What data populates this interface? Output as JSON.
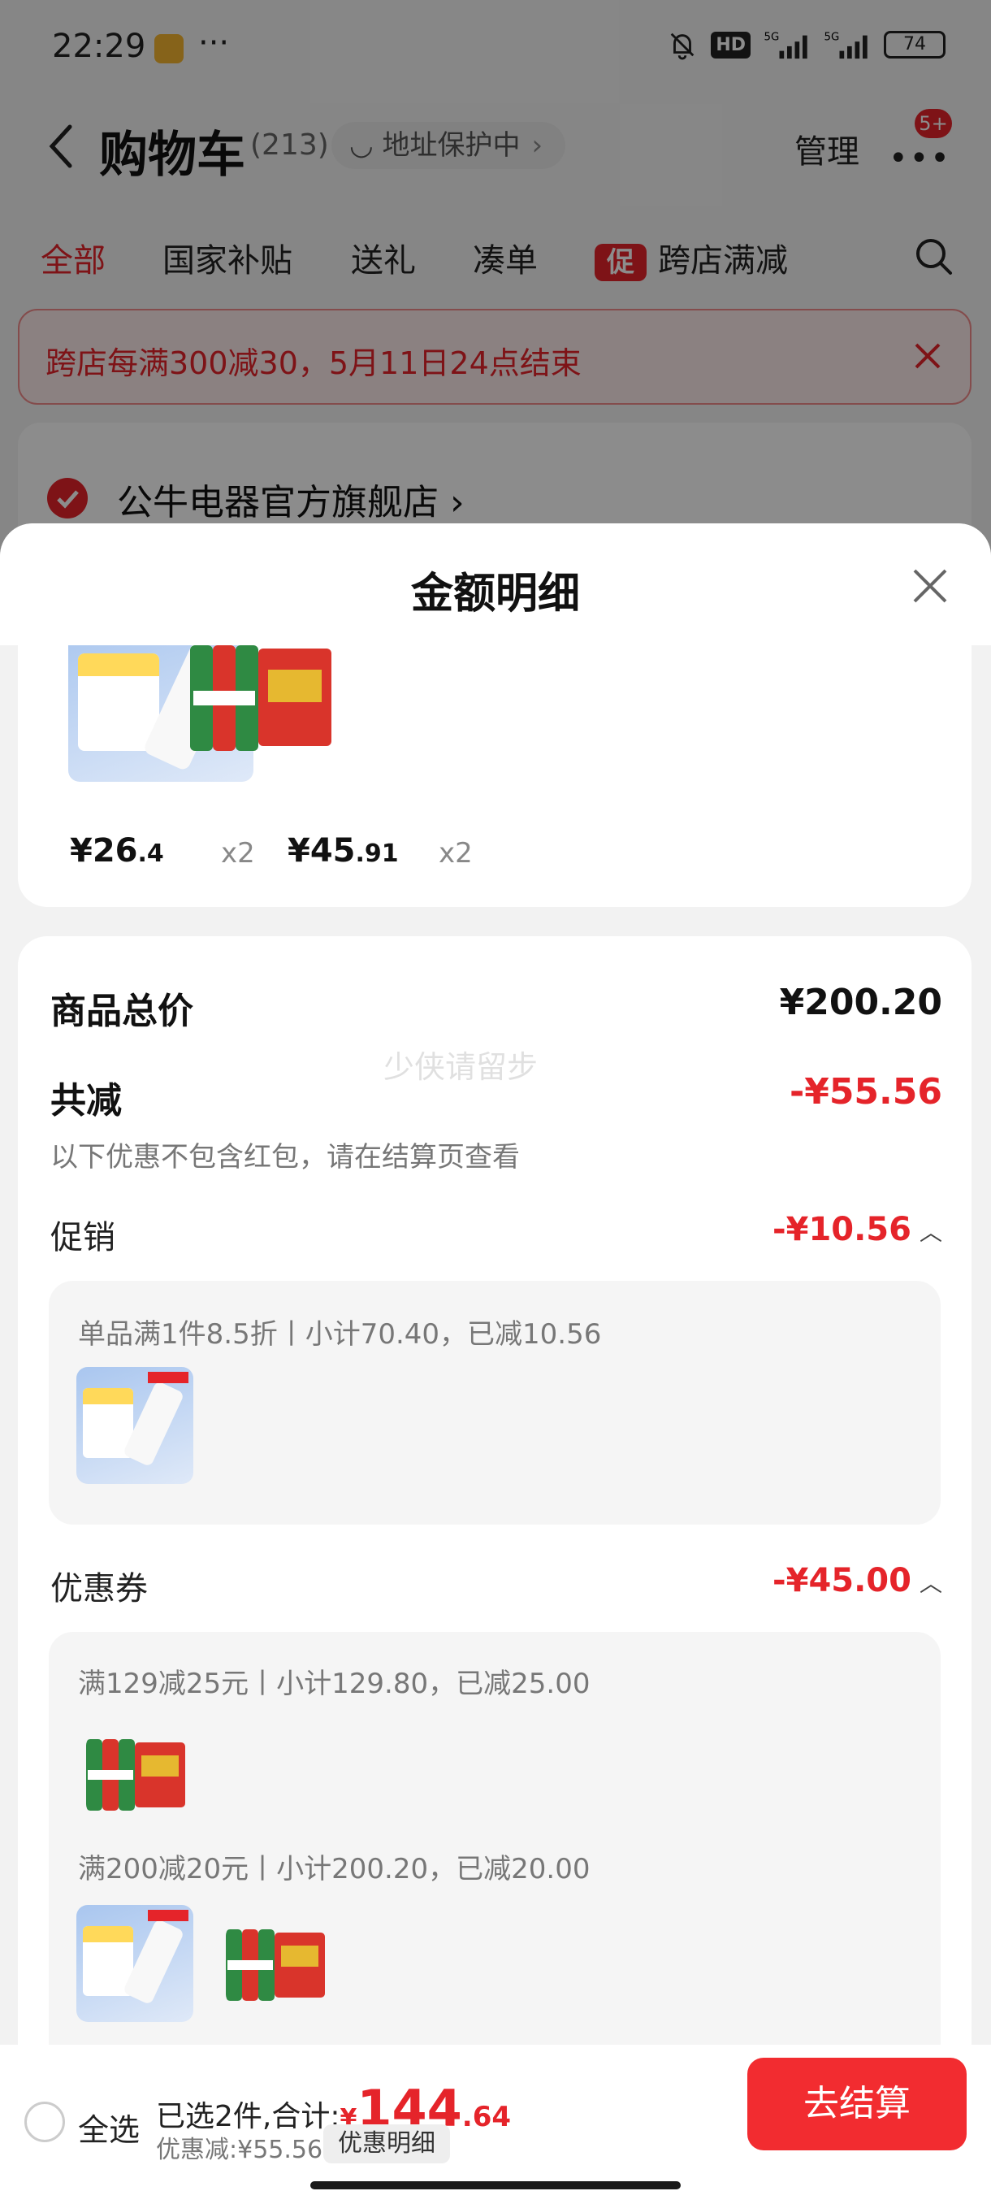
{
  "status_bar": {
    "time": "22:29",
    "dots": "···",
    "hd": "HD",
    "network_1": "5G",
    "network_2": "5G",
    "battery": "74"
  },
  "header": {
    "title": "购物车",
    "count": "(213)",
    "address": "地址保护中",
    "manage": "管理",
    "badge": "5+"
  },
  "tabs": [
    {
      "label": "全部",
      "active": true
    },
    {
      "label": "国家补贴"
    },
    {
      "label": "送礼"
    },
    {
      "label": "凑单"
    },
    {
      "tag": "促",
      "label": "跨店满减"
    }
  ],
  "notice": {
    "text": "跨店每满300减30，5月11日24点结束"
  },
  "shop": {
    "name": "公牛电器官方旗舰店"
  },
  "sheet": {
    "title": "金额明细",
    "items": [
      {
        "price_int": "¥26",
        "price_dec": ".4",
        "qty": "x2",
        "thumb": "power-strip"
      },
      {
        "price_int": "¥45",
        "price_dec": ".91",
        "qty": "x2",
        "thumb": "wusu-beer-pack"
      }
    ],
    "watermark": "少侠请留步",
    "total_label": "商品总价",
    "total_value": "¥200.20",
    "reduce_label": "共减",
    "reduce_value": "-¥55.56",
    "reduce_note": "以下优惠不包含红包，请在结算页查看",
    "promo": {
      "label": "促销",
      "value": "-¥10.56",
      "rule": "单品满1件8.5折丨小计70.40，已减10.56"
    },
    "coupon": {
      "label": "优惠券",
      "value": "-¥45.00",
      "rules": [
        "满129减25元丨小计129.80，已减25.00",
        "满200减20元丨小计200.20，已减20.00"
      ]
    }
  },
  "bottom_bar": {
    "select_all": "全选",
    "selected_text": "已选2件,合计:",
    "currency": "¥",
    "total_int": "144",
    "total_dec": ".64",
    "discount_text": "优惠减:¥55.56",
    "detail_button": "优惠明细",
    "checkout": "去结算"
  },
  "colors": {
    "accent": "#e5242a",
    "checkout": "#f22c30"
  }
}
